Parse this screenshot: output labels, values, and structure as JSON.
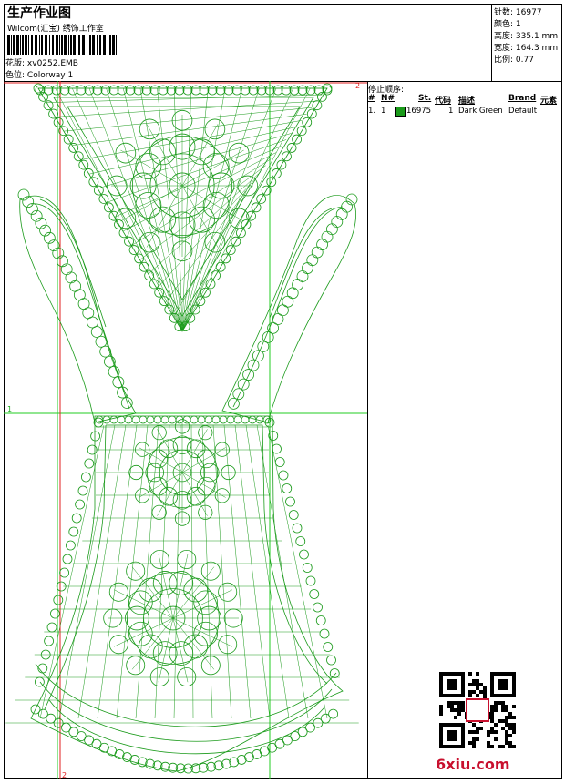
{
  "header": {
    "title": "生产作业图",
    "company": "Wilcom(汇宝) 绣饰工作室",
    "design_label": "花版:",
    "design_value": "xv0252.EMB",
    "color_label": "色位:",
    "color_value": "Colorway 1"
  },
  "stats": [
    {
      "label": "针数:",
      "value": "16977"
    },
    {
      "label": "颜色:",
      "value": "1"
    },
    {
      "label": "高度:",
      "value": "335.1 mm"
    },
    {
      "label": "宽度:",
      "value": "164.3 mm"
    },
    {
      "label": "比例:",
      "value": "0.77"
    }
  ],
  "guides": {
    "corner_label": "2",
    "side_label": "1",
    "bottom_label": "2"
  },
  "stop_sequence": {
    "title": "停止顺序:",
    "columns": [
      "#",
      "N#",
      "St.",
      "代码",
      "描述",
      "Brand",
      "元素"
    ],
    "rows": [
      {
        "index": "1.",
        "needle": "1",
        "stitches": "16975",
        "code": "1",
        "description": "Dark Green",
        "brand": "Default",
        "color": "#1a9a1a"
      }
    ]
  },
  "embroidery_color": "#1a9a1a",
  "watermark": "6xiu.com"
}
